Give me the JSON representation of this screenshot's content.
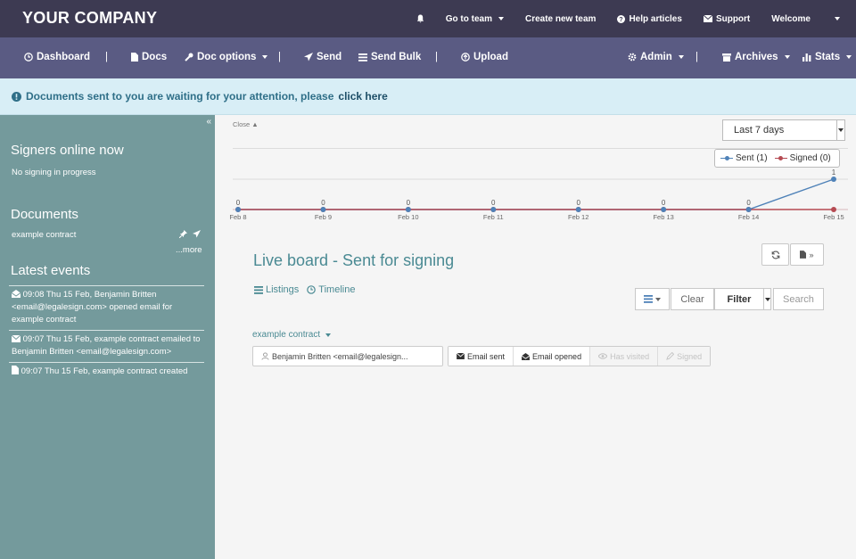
{
  "topbar": {
    "brand": "YOUR COMPANY",
    "go_to_team": "Go to team",
    "create_team": "Create new team",
    "help": "Help articles",
    "support": "Support",
    "welcome": "Welcome"
  },
  "navbar": {
    "dashboard": "Dashboard",
    "docs": "Docs",
    "doc_options": "Doc options",
    "send": "Send",
    "send_bulk": "Send Bulk",
    "upload": "Upload",
    "admin": "Admin",
    "archives": "Archives",
    "stats": "Stats",
    "separator": "|"
  },
  "alert": {
    "text": "Documents sent to you are waiting for your attention, please",
    "link": "click here"
  },
  "sidebar": {
    "collapse": "«",
    "signers_title": "Signers online now",
    "signers_status": "No signing in progress",
    "documents_title": "Documents",
    "document_name": "example contract",
    "more": "...more",
    "events_title": "Latest events",
    "events": [
      "09:08 Thu 15 Feb, Benjamin Britten <email@legalesign.com> opened email for example contract",
      "09:07 Thu 15 Feb, example contract emailed to Benjamin Britten <email@legalesign.com>",
      "09:07 Thu 15 Feb, example contract created"
    ]
  },
  "main": {
    "close": "Close",
    "period": "Last 7 days",
    "board_title": "Live board - Sent for signing",
    "tab_listings": "Listings",
    "tab_timeline": "Timeline",
    "clear": "Clear",
    "filter": "Filter",
    "search_placeholder": "Search",
    "doc_name": "example contract",
    "signer": "Benjamin Britten <email@legalesign...",
    "states": {
      "email_sent": "Email sent",
      "email_opened": "Email opened",
      "has_visited": "Has visited",
      "signed": "Signed"
    }
  },
  "chart_data": {
    "type": "line",
    "categories": [
      "Feb 8",
      "Feb 9",
      "Feb 10",
      "Feb 11",
      "Feb 12",
      "Feb 13",
      "Feb 14",
      "Feb 15"
    ],
    "series": [
      {
        "name": "Sent (1)",
        "color": "#4f82b8",
        "values": [
          0,
          0,
          0,
          0,
          0,
          0,
          0,
          1
        ]
      },
      {
        "name": "Signed (0)",
        "color": "#b54a52",
        "values": [
          0,
          0,
          0,
          0,
          0,
          0,
          0,
          0
        ]
      }
    ],
    "ylim": [
      0,
      1
    ],
    "legend": "top-right"
  },
  "colors": {
    "topbar": "#3d3a52",
    "navbar": "#5a5b83",
    "sidebar": "#749a9c",
    "accent": "#4a8a93"
  }
}
